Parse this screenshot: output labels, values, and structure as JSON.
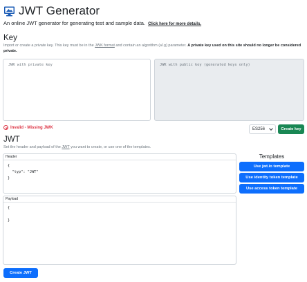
{
  "app": {
    "title": "JWT Generator",
    "subtitle": "An online JWT generator for generating test and sample data.",
    "more_link": "Click here for more details.",
    "logo_icon": "computer-icon"
  },
  "key_section": {
    "heading": "Key",
    "desc_part1": "Import or create a private key. This key must be in the ",
    "desc_jwk": "JWK format",
    "desc_part2": " and contain an algorithm (",
    "desc_alg": "alg",
    "desc_part3": ") parameter. ",
    "desc_bold": "A private key used on this site should no longer be considered private.",
    "private_placeholder": "JWK with private key",
    "public_placeholder": "JWK with public key (generated keys only)",
    "status": "Invalid - Missing JWK",
    "algorithm_selected": "ES256",
    "create_key_button": "Create key"
  },
  "jwt_section": {
    "heading": "JWT",
    "desc_part1": "Set the header and payload of the ",
    "desc_jwt": "JWT",
    "desc_part2": " you want to create, or use one of the templates.",
    "header_label": "Header",
    "header_value": "{\n  \"typ\": \"JWT\"\n}",
    "payload_label": "Payload",
    "payload_value": "{\n\n}",
    "templates_title": "Templates",
    "template_buttons": [
      "Use jwt.io template",
      "Use identity token template",
      "Use access token template"
    ],
    "create_jwt_button": "Create JWT"
  },
  "colors": {
    "primary": "#0d6efd",
    "success": "#198754",
    "danger": "#dc3545",
    "muted": "#6c757d"
  }
}
